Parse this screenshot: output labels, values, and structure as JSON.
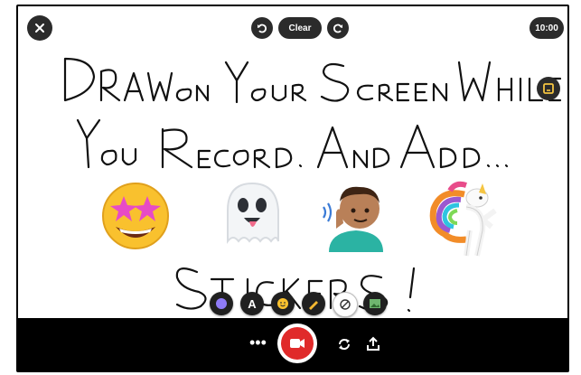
{
  "toolbar_top": {
    "close_icon": "close-icon",
    "undo_icon": "undo-icon",
    "clear_label": "Clear",
    "redo_icon": "redo-icon",
    "timer": "10:00"
  },
  "side": {
    "icon": "square-note-icon"
  },
  "canvas": {
    "handwriting_line1": "DRAW ON YOUR SCREEN WHILE",
    "handwriting_line2": "YOU RECORD. AND ADD...",
    "handwriting_line3": "STICKERS!",
    "stickers": [
      "star-struck-emoji",
      "ghost-emoji",
      "man-with-hearing-aid-emoji",
      "unicorn-sticker"
    ]
  },
  "drawing_tools": [
    "sticker-tool-icon",
    "text-tool-icon",
    "emoji-tool-icon",
    "pen-tool-icon",
    "eraser-tool-icon",
    "image-tool-icon"
  ],
  "drawing_tools_text": {
    "text_tool": "A"
  },
  "bottom": {
    "more": "•••",
    "record_icon": "video-camera-icon",
    "flip_icon": "flip-camera-icon",
    "share_icon": "upload-icon"
  },
  "colors": {
    "accent_red": "#e02a2a",
    "dark": "#2b2b2b"
  }
}
